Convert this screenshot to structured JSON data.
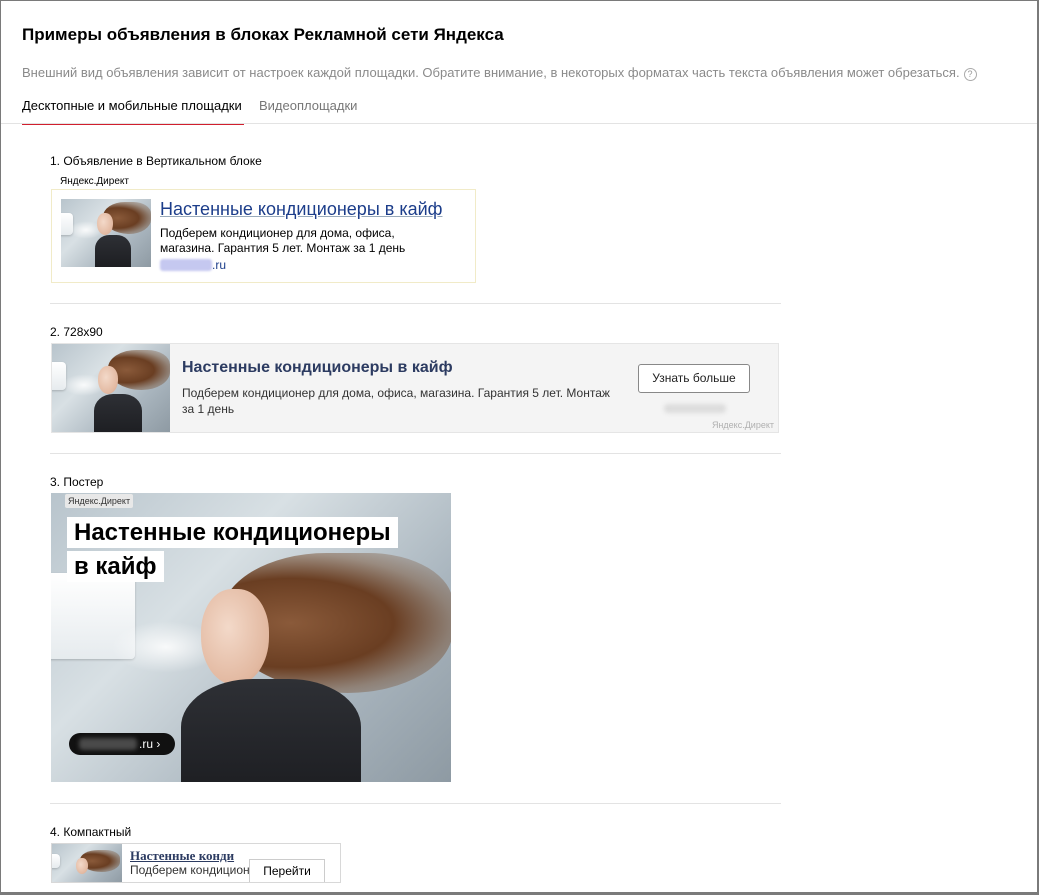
{
  "modal": {
    "title": "Примеры объявления в блоках Рекламной сети Яндекса",
    "subtitle": "Внешний вид объявления зависит от настроек каждой площадки. Обратите внимание, в некоторых форматах часть текста объявления может обрезаться.",
    "help_icon": "?"
  },
  "tabs": [
    {
      "label": "Десктопные и мобильные площадки",
      "active": true
    },
    {
      "label": "Видеоплощадки",
      "active": false
    }
  ],
  "sections": [
    {
      "label": "1. Объявление в Вертикальном блоке"
    },
    {
      "label": "2. 728x90"
    },
    {
      "label": "3. Постер"
    },
    {
      "label": "4. Компактный"
    }
  ],
  "ad": {
    "brand": "Яндекс.Директ",
    "title": "Настенные кондиционеры в кайф",
    "title_line1": "Настенные кондиционеры",
    "title_line2": "в кайф",
    "text": "Подберем кондиционер для дома, офиса, магазина. Гарантия 5 лет. Монтаж за 1 день",
    "domain_suffix": ".ru",
    "more_button": "Узнать больше",
    "poster_domain_suffix": ".ru ›",
    "compact_title": "Настенные конди",
    "compact_text": "Подберем кондицион",
    "go_button": "Перейти"
  },
  "colors": {
    "tab_underline": "#d11f2e",
    "link": "#1c3d8a",
    "ad_title_dark": "#2c3b61"
  }
}
